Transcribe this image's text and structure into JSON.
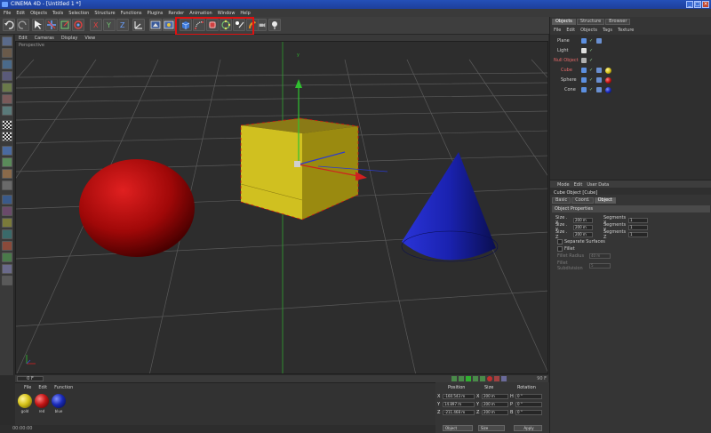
{
  "window": {
    "title": "CINEMA 4D - [Untitled 1 *]",
    "buttons": [
      "_",
      "□",
      "×"
    ]
  },
  "menubar": [
    "File",
    "Edit",
    "Objects",
    "Tools",
    "Selection",
    "Structure",
    "Functions",
    "Plugins",
    "Render",
    "Animation",
    "Window",
    "Help"
  ],
  "viewport": {
    "menu": [
      "Edit",
      "Cameras",
      "Display",
      "View"
    ],
    "label": "Perspective",
    "axis_label": "y"
  },
  "timeline": {
    "frame": "0 F",
    "end_frame": "90 F"
  },
  "materials": {
    "menu": [
      "File",
      "Edit",
      "Function"
    ],
    "items": [
      {
        "label": "gold",
        "color": "#d6c21a"
      },
      {
        "label": "red",
        "color": "#c41616"
      },
      {
        "label": "blue",
        "color": "#1a2ab8"
      }
    ]
  },
  "coordinates": {
    "headers": {
      "position": "Position",
      "size": "Size",
      "rotation": "Rotation"
    },
    "rows": [
      {
        "axis": "X",
        "pos": "-160.543 m",
        "size_axis": "X",
        "size": "200 m",
        "rot_axis": "H",
        "rot": "0 °"
      },
      {
        "axis": "Y",
        "pos": "14.897 m",
        "size_axis": "Y",
        "size": "200 m",
        "rot_axis": "P",
        "rot": "0 °"
      },
      {
        "axis": "Z",
        "pos": "-211.468 m",
        "size_axis": "Z",
        "size": "200 m",
        "rot_axis": "B",
        "rot": "0 °"
      }
    ],
    "mode_select": "Object",
    "size_select": "Size",
    "apply_label": "Apply"
  },
  "object_manager": {
    "tabs": [
      "Objects",
      "Structure",
      "Browser"
    ],
    "menu": [
      "File",
      "Edit",
      "Objects",
      "Tags",
      "Texture"
    ],
    "items": [
      {
        "name": "Plane",
        "indent": 0,
        "icon_color": "#5c8fe0",
        "selected": false,
        "mats": []
      },
      {
        "name": "Light",
        "indent": 0,
        "icon_color": "#e0e0e0",
        "selected": false,
        "mats": []
      },
      {
        "name": "Null Object",
        "indent": 0,
        "icon_color": "#b0b0b0",
        "selected": false,
        "mats": []
      },
      {
        "name": "Cube",
        "indent": 1,
        "icon_color": "#5c8fe0",
        "selected": true,
        "mats": [
          "#d6c21a"
        ]
      },
      {
        "name": "Sphere",
        "indent": 1,
        "icon_color": "#5c8fe0",
        "selected": false,
        "mats": [
          "#c41616"
        ]
      },
      {
        "name": "Cone",
        "indent": 1,
        "icon_color": "#5c8fe0",
        "selected": false,
        "mats": [
          "#1a2ab8"
        ]
      }
    ]
  },
  "attributes": {
    "menu": [
      "Mode",
      "Edit",
      "User Data"
    ],
    "title": "Cube Object [Cube]",
    "tabs": [
      "Basic",
      "Coord.",
      "Object"
    ],
    "active_tab": "Object",
    "section": "Object Properties",
    "size": [
      {
        "label": "Size . X",
        "value": "200 m",
        "seg_label": "Segments X",
        "seg": "1"
      },
      {
        "label": "Size . Y",
        "value": "200 m",
        "seg_label": "Segments Y",
        "seg": "1"
      },
      {
        "label": "Size . Z",
        "value": "200 m",
        "seg_label": "Segments Z",
        "seg": "1"
      }
    ],
    "separate_surfaces": "Separate Surfaces",
    "fillet": "Fillet",
    "fillet_radius": {
      "label": "Fillet Radius",
      "value": "40 m"
    },
    "fillet_subdivision": {
      "label": "Fillet Subdivision",
      "value": "5"
    }
  },
  "status": "00:00:00",
  "accent": "#e01010"
}
